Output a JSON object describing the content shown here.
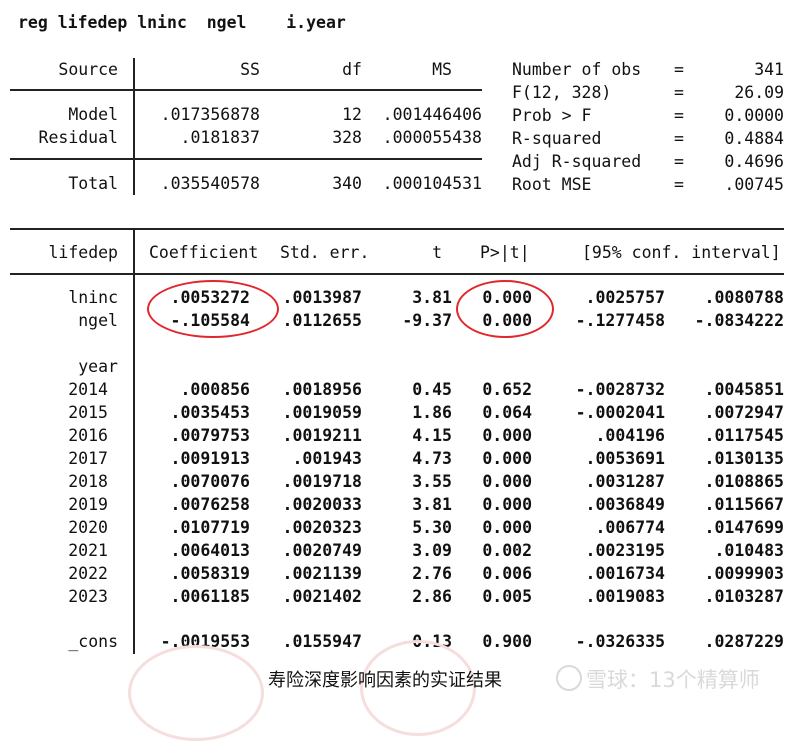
{
  "command": "reg lifedep lninc  ngel    i.year",
  "anova": {
    "headers": {
      "source": "Source",
      "ss": "SS",
      "df": "df",
      "ms": "MS"
    },
    "rows": [
      {
        "source": "Model",
        "ss": ".017356878",
        "df": "12",
        "ms": ".001446406"
      },
      {
        "source": "Residual",
        "ss": ".0181837",
        "df": "328",
        "ms": ".000055438"
      }
    ],
    "total": {
      "source": "Total",
      "ss": ".035540578",
      "df": "340",
      "ms": ".000104531"
    }
  },
  "stats": [
    {
      "label": "Number of obs",
      "eq": "=",
      "value": "341"
    },
    {
      "label": "F(12, 328)",
      "eq": "=",
      "value": "26.09"
    },
    {
      "label": "Prob > F",
      "eq": "=",
      "value": "0.0000"
    },
    {
      "label": "R-squared",
      "eq": "=",
      "value": "0.4884"
    },
    {
      "label": "Adj R-squared",
      "eq": "=",
      "value": "0.4696"
    },
    {
      "label": "Root MSE",
      "eq": "=",
      "value": ".00745"
    }
  ],
  "coef": {
    "headers": {
      "dep": "lifedep",
      "coef": "Coefficient",
      "se": "Std. err.",
      "t": "t",
      "p": "P>|t|",
      "ci": "[95% conf. interval]"
    },
    "year_label": "year",
    "rows": [
      {
        "name": "lninc",
        "coef": ".0053272",
        "se": ".0013987",
        "t": "3.81",
        "p": "0.000",
        "lo": ".0025757",
        "hi": ".0080788"
      },
      {
        "name": "ngel",
        "coef": "-.105584",
        "se": ".0112655",
        "t": "-9.37",
        "p": "0.000",
        "lo": "-.1277458",
        "hi": "-.0834222"
      },
      {
        "name": "2014",
        "coef": ".000856",
        "se": ".0018956",
        "t": "0.45",
        "p": "0.652",
        "lo": "-.0028732",
        "hi": ".0045851"
      },
      {
        "name": "2015",
        "coef": ".0035453",
        "se": ".0019059",
        "t": "1.86",
        "p": "0.064",
        "lo": "-.0002041",
        "hi": ".0072947"
      },
      {
        "name": "2016",
        "coef": ".0079753",
        "se": ".0019211",
        "t": "4.15",
        "p": "0.000",
        "lo": ".004196",
        "hi": ".0117545"
      },
      {
        "name": "2017",
        "coef": ".0091913",
        "se": ".001943",
        "t": "4.73",
        "p": "0.000",
        "lo": ".0053691",
        "hi": ".0130135"
      },
      {
        "name": "2018",
        "coef": ".0070076",
        "se": ".0019718",
        "t": "3.55",
        "p": "0.000",
        "lo": ".0031287",
        "hi": ".0108865"
      },
      {
        "name": "2019",
        "coef": ".0076258",
        "se": ".0020033",
        "t": "3.81",
        "p": "0.000",
        "lo": ".0036849",
        "hi": ".0115667"
      },
      {
        "name": "2020",
        "coef": ".0107719",
        "se": ".0020323",
        "t": "5.30",
        "p": "0.000",
        "lo": ".006774",
        "hi": ".0147699"
      },
      {
        "name": "2021",
        "coef": ".0064013",
        "se": ".0020749",
        "t": "3.09",
        "p": "0.002",
        "lo": ".0023195",
        "hi": ".010483"
      },
      {
        "name": "2022",
        "coef": ".0058319",
        "se": ".0021139",
        "t": "2.76",
        "p": "0.006",
        "lo": ".0016734",
        "hi": ".0099903"
      },
      {
        "name": "2023",
        "coef": ".0061185",
        "se": ".0021402",
        "t": "2.86",
        "p": "0.005",
        "lo": ".0019083",
        "hi": ".0103287"
      },
      {
        "name": "_cons",
        "coef": "-.0019553",
        "se": ".0155947",
        "t": "-0.13",
        "p": "0.900",
        "lo": "-.0326335",
        "hi": ".0287229"
      }
    ]
  },
  "caption": "寿险深度影响因素的实证结果",
  "watermark": "雪球：13个精算师",
  "colors": {
    "annotation_circle": "#e0282c",
    "text": "#111111"
  }
}
